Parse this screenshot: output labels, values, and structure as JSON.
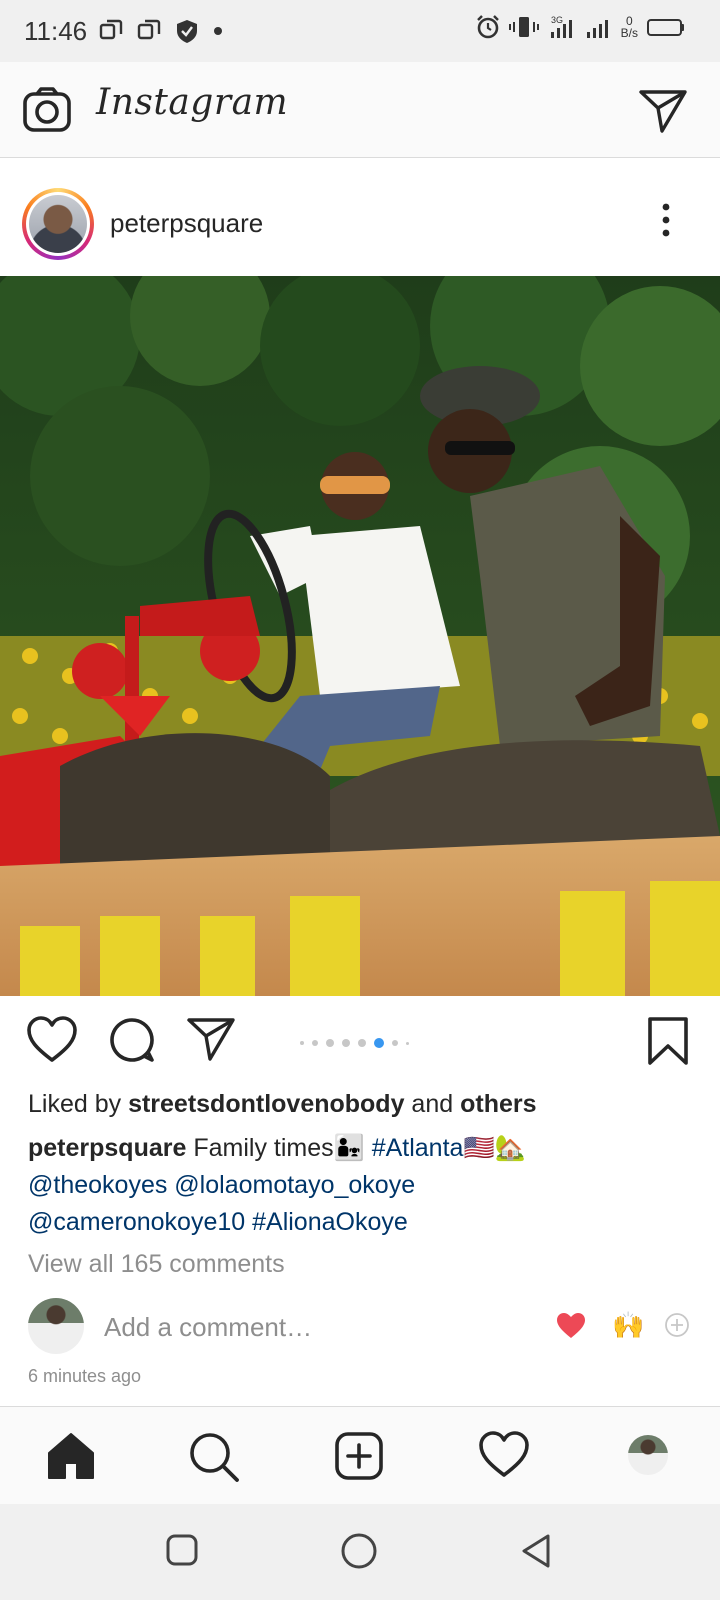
{
  "status_bar": {
    "time": "11:46",
    "net_speed_value": "0",
    "net_speed_unit": "B/s",
    "network_type": "3G"
  },
  "app": {
    "title": "Instagram"
  },
  "post": {
    "username": "peterpsquare",
    "photo_description_icon": "photo",
    "carousel": {
      "count": 8,
      "active_index": 5
    },
    "likes_prefix": "Liked by ",
    "likes_user": "streetsdontlovenobody",
    "likes_middle": " and ",
    "likes_suffix": "others",
    "caption_user": "peterpsquare",
    "caption_text": " Family times👨‍👧 ",
    "caption_tags": {
      "atlanta": "#Atlanta🇺🇸🏡",
      "theokoyes": "@theokoyes",
      "lolaomotayo": "@lolaomotayo_okoye",
      "cameronokoye": "@cameronokoye10",
      "alionaokoye": "#AlionaOkoye"
    },
    "view_comments": "View all 165 comments",
    "comment_placeholder": "Add a comment…",
    "quick_reactions": [
      "❤️",
      "🙌"
    ],
    "timestamp": "6 minutes ago"
  },
  "colors": {
    "link": "#003569",
    "muted": "#8e8e8e",
    "carousel_active": "#3897f0",
    "heart_red": "#ed4956"
  },
  "bottom_nav": [
    "home-icon",
    "search-icon",
    "new-post-icon",
    "activity-heart-icon",
    "profile-avatar"
  ],
  "android_nav": [
    "recents-button",
    "home-button",
    "back-button"
  ]
}
